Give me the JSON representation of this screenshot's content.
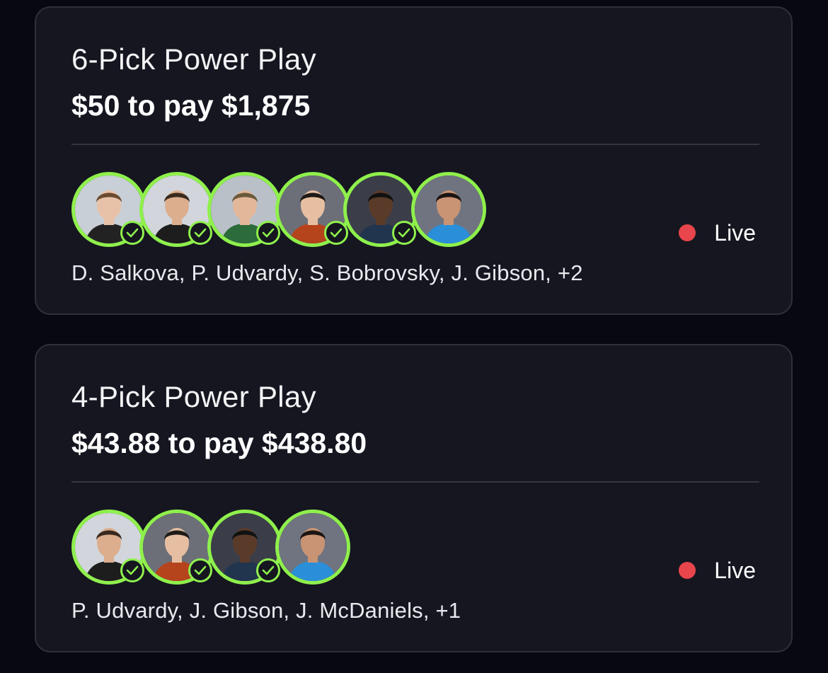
{
  "colors": {
    "background": "#070810",
    "card": "#151620",
    "accent_green": "#8ff04c",
    "live_red": "#e8454c"
  },
  "entries": [
    {
      "title": "6-Pick Power Play",
      "payout": "$50 to pay $1,875",
      "status": "Live",
      "players_summary": "D. Salkova, P. Udvardy, S. Bobrovsky, J. Gibson, +2",
      "picks": [
        {
          "avatar": "player-photo",
          "checked": true
        },
        {
          "avatar": "player-photo",
          "checked": true
        },
        {
          "avatar": "player-photo",
          "checked": true
        },
        {
          "avatar": "player-photo",
          "checked": true
        },
        {
          "avatar": "player-photo",
          "checked": true
        },
        {
          "avatar": "player-photo",
          "checked": false
        }
      ]
    },
    {
      "title": "4-Pick Power Play",
      "payout": "$43.88 to pay $438.80",
      "status": "Live",
      "players_summary": "P. Udvardy, J. Gibson, J. McDaniels, +1",
      "picks": [
        {
          "avatar": "player-photo",
          "checked": true
        },
        {
          "avatar": "player-photo",
          "checked": true
        },
        {
          "avatar": "player-photo",
          "checked": true
        },
        {
          "avatar": "player-photo",
          "checked": false
        }
      ]
    }
  ]
}
